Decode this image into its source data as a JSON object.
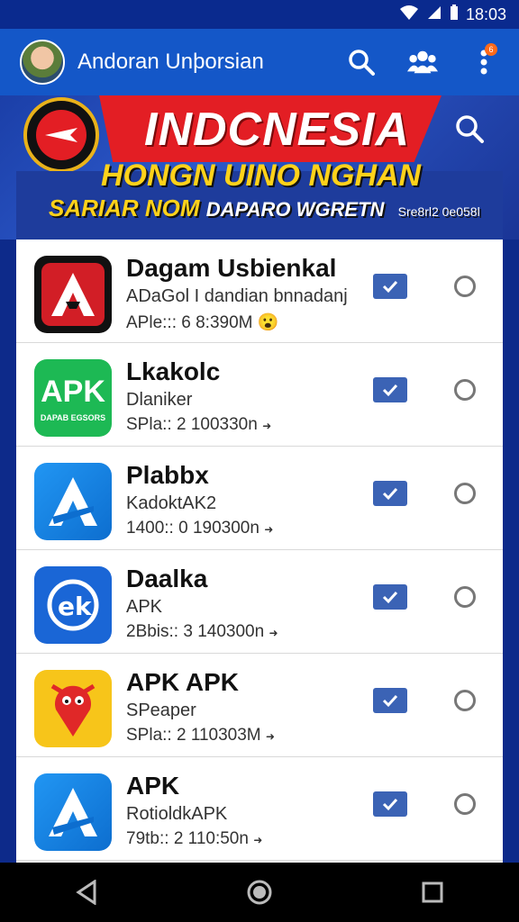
{
  "status_bar": {
    "time": "18:03"
  },
  "app_bar": {
    "title": "Andoran Unþorsian",
    "notification_count": "6"
  },
  "banner": {
    "title": "INDCNESIA",
    "subtitle": "HONGN UINO NGHAN",
    "subtitle2_left": "SARIAR NOM",
    "subtitle2_right": "DAPARO WGRETN",
    "subtitle2_small": "Sre8rl2 0e058l"
  },
  "apps": [
    {
      "name": "Dagam Usbienkal",
      "desc": "ADaGol I dandian bnnadanj",
      "meta": "APle::: 6 8:390M",
      "icon_color": "#d21e26",
      "icon_label": "A"
    },
    {
      "name": "Lkakolc",
      "desc": "Dlaniker",
      "meta": "SPla:: 2 100330n",
      "icon_color": "#1db954",
      "icon_label": "APK",
      "icon_small": "DAPAB EGSORS"
    },
    {
      "name": "Plabbx",
      "desc": "KadoktAK2",
      "meta": "1400:: 0 190300n",
      "icon_color": "#1e88e5",
      "icon_label": "A"
    },
    {
      "name": "Daalka",
      "desc": "APK",
      "meta": "2Bbis:: 3 140300n",
      "icon_color": "#1a66d6",
      "icon_label": "ek"
    },
    {
      "name": "APK APK",
      "desc": "SPeaper",
      "meta": "SPla:: 2 110303M",
      "icon_color": "#f7c51a",
      "icon_label": ""
    },
    {
      "name": "APK",
      "desc": "RotioldkAPK",
      "meta": "79tb:: 2 110:50n",
      "icon_color": "#1e88e5",
      "icon_label": "A"
    }
  ],
  "colors": {
    "app_bar": "#1457c8",
    "status_bar": "#0a2a8e",
    "banner_red": "#e31e24",
    "banner_yellow": "#ffd21a",
    "download_btn": "#3b63b5"
  }
}
